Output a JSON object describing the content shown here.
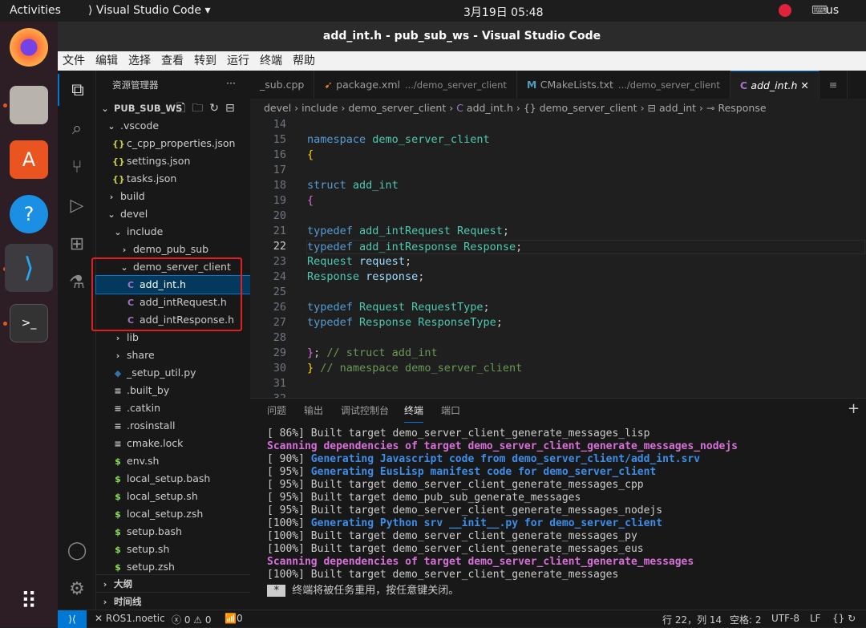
{
  "topbar": {
    "activities": "Activities",
    "app": "Visual Studio Code ▾",
    "clock": "3月19日  05:48",
    "keyboard": "us"
  },
  "dock": {
    "items": [
      "firefox",
      "files",
      "app-center",
      "help",
      "vscode",
      "terminal"
    ]
  },
  "window": {
    "title": "add_int.h - pub_sub_ws - Visual Studio Code"
  },
  "menu": [
    "文件",
    "编辑",
    "选择",
    "查看",
    "转到",
    "运行",
    "终端",
    "帮助"
  ],
  "sidebar": {
    "title": "资源管理器",
    "more": "···",
    "root": "PUB_SUB_WS",
    "items": [
      {
        "label": ".vscode",
        "icon": "chevron-down",
        "indent": 1
      },
      {
        "label": "c_cpp_properties.json",
        "icon": "json",
        "indent": 2
      },
      {
        "label": "settings.json",
        "icon": "json",
        "indent": 2
      },
      {
        "label": "tasks.json",
        "icon": "json",
        "indent": 2
      },
      {
        "label": "build",
        "icon": "chevron-right",
        "indent": 1
      },
      {
        "label": "devel",
        "icon": "chevron-down",
        "indent": 1
      },
      {
        "label": "include",
        "icon": "chevron-down",
        "indent": 2
      },
      {
        "label": "demo_pub_sub",
        "icon": "chevron-right",
        "indent": 3
      },
      {
        "label": "demo_server_client",
        "icon": "chevron-down",
        "indent": 3
      },
      {
        "label": "add_int.h",
        "icon": "c",
        "indent": 4,
        "selected": true
      },
      {
        "label": "add_intRequest.h",
        "icon": "c",
        "indent": 4
      },
      {
        "label": "add_intResponse.h",
        "icon": "c",
        "indent": 4
      },
      {
        "label": "lib",
        "icon": "chevron-right",
        "indent": 2
      },
      {
        "label": "share",
        "icon": "chevron-right",
        "indent": 2
      },
      {
        "label": "_setup_util.py",
        "icon": "python",
        "indent": 2
      },
      {
        "label": ".built_by",
        "icon": "lines",
        "indent": 2
      },
      {
        "label": ".catkin",
        "icon": "lines",
        "indent": 2
      },
      {
        "label": ".rosinstall",
        "icon": "lines",
        "indent": 2
      },
      {
        "label": "cmake.lock",
        "icon": "lines",
        "indent": 2
      },
      {
        "label": "env.sh",
        "icon": "dollar",
        "indent": 2
      },
      {
        "label": "local_setup.bash",
        "icon": "dollar",
        "indent": 2
      },
      {
        "label": "local_setup.sh",
        "icon": "dollar",
        "indent": 2
      },
      {
        "label": "local_setup.zsh",
        "icon": "dollar",
        "indent": 2
      },
      {
        "label": "setup.bash",
        "icon": "dollar",
        "indent": 2
      },
      {
        "label": "setup.sh",
        "icon": "dollar",
        "indent": 2
      },
      {
        "label": "setup.zsh",
        "icon": "dollar",
        "indent": 2
      }
    ],
    "outline": "大纲",
    "timeline": "时间线"
  },
  "tabs": [
    {
      "label": "_sub.cpp",
      "dir": ""
    },
    {
      "label": "package.xml",
      "dir": ".../demo_server_client"
    },
    {
      "label": "CMakeLists.txt",
      "dir": ".../demo_server_client"
    },
    {
      "label": "add_int.h",
      "dir": "",
      "active": true
    }
  ],
  "breadcrumb": [
    "devel",
    "include",
    "demo_server_client",
    "add_int.h",
    "demo_server_client",
    "add_int",
    "Response"
  ],
  "code": {
    "start": 14,
    "current": 22,
    "lines": [
      "",
      "namespace demo_server_client",
      "{",
      "",
      "struct add_int",
      "{",
      "",
      "typedef add_intRequest Request;",
      "typedef add_intResponse Response;",
      "Request request;",
      "Response response;",
      "",
      "typedef Request RequestType;",
      "typedef Response ResponseType;",
      "",
      "}; // struct add_int",
      "} // namespace demo_server_client",
      "",
      ""
    ]
  },
  "panel": {
    "tabs": [
      "问题",
      "输出",
      "调试控制台",
      "终端",
      "端口"
    ],
    "active": "终端",
    "terminal": [
      {
        "t": "[ 86%] Built target demo_server_client_generate_messages_lisp",
        "s": ""
      },
      {
        "t": "Scanning dependencies of target demo_server_client_generate_messages_nodejs",
        "s": "mag"
      },
      {
        "p": "[ 90%] ",
        "t": "Generating Javascript code from demo_server_client/add_int.srv",
        "s": "blu"
      },
      {
        "p": "[ 95%] ",
        "t": "Generating EusLisp manifest code for demo_server_client",
        "s": "blu"
      },
      {
        "t": "[ 95%] Built target demo_server_client_generate_messages_cpp",
        "s": ""
      },
      {
        "t": "[ 95%] Built target demo_pub_sub_generate_messages",
        "s": ""
      },
      {
        "t": "[ 95%] Built target demo_server_client_generate_messages_nodejs",
        "s": ""
      },
      {
        "p": "[100%] ",
        "t": "Generating Python srv __init__.py for demo_server_client",
        "s": "blu"
      },
      {
        "t": "[100%] Built target demo_server_client_generate_messages_py",
        "s": ""
      },
      {
        "t": "[100%] Built target demo_server_client_generate_messages_eus",
        "s": ""
      },
      {
        "t": "Scanning dependencies of target demo_server_client_generate_messages",
        "s": "mag"
      },
      {
        "t": "[100%] Built target demo_server_client_generate_messages",
        "s": ""
      }
    ],
    "final_badge": " * ",
    "final": " 终端将被任务重用，按任意键关闭。"
  },
  "status": {
    "remote": "ROS1.noetic",
    "errors": "0",
    "warnings": "0",
    "ports": "0",
    "position": "行 22，列 14",
    "spaces": "空格: 2",
    "encoding": "UTF-8",
    "eol": "LF"
  },
  "colors": {
    "accent": "#0078d4",
    "highlight_box": "#e02020"
  }
}
